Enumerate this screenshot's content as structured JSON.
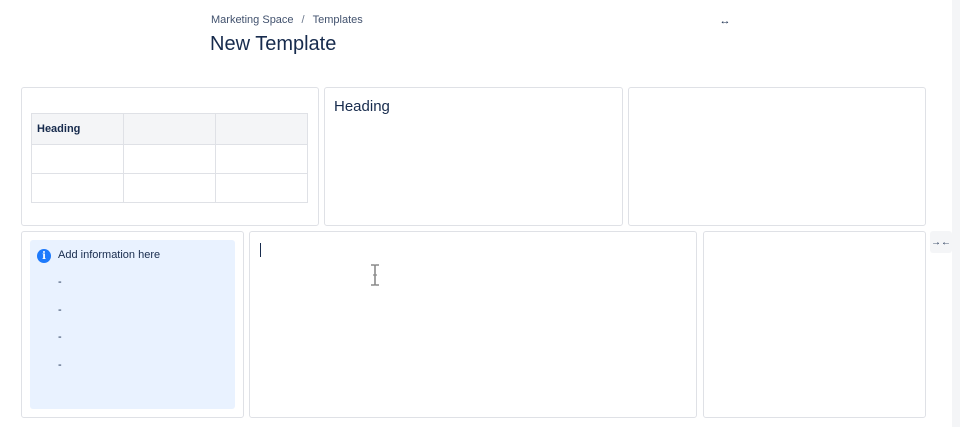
{
  "breadcrumb": {
    "items": [
      "Marketing Space",
      "Templates"
    ],
    "separator": "/"
  },
  "page": {
    "title": "New Template"
  },
  "toolbar": {
    "expand_icon": "↔",
    "collapse_icon": "→←"
  },
  "layout": {
    "row1": {
      "table": {
        "rows": [
          [
            "Heading",
            "",
            ""
          ],
          [
            "",
            "",
            ""
          ],
          [
            "",
            "",
            ""
          ]
        ]
      },
      "middle_heading": "Heading"
    },
    "row2": {
      "info_panel": {
        "title": "Add information here",
        "items": [
          "-",
          "-",
          "-",
          "-"
        ]
      }
    }
  },
  "colors": {
    "info_background": "#e9f2ff",
    "info_icon": "#1d7afc",
    "border": "#dfe1e6",
    "table_header": "#f4f5f7",
    "text": "#172b4d"
  },
  "icons": {
    "info": "info-icon",
    "expand": "expand-icon",
    "collapse": "collapse-icon",
    "cursor": "text-cursor-icon"
  }
}
